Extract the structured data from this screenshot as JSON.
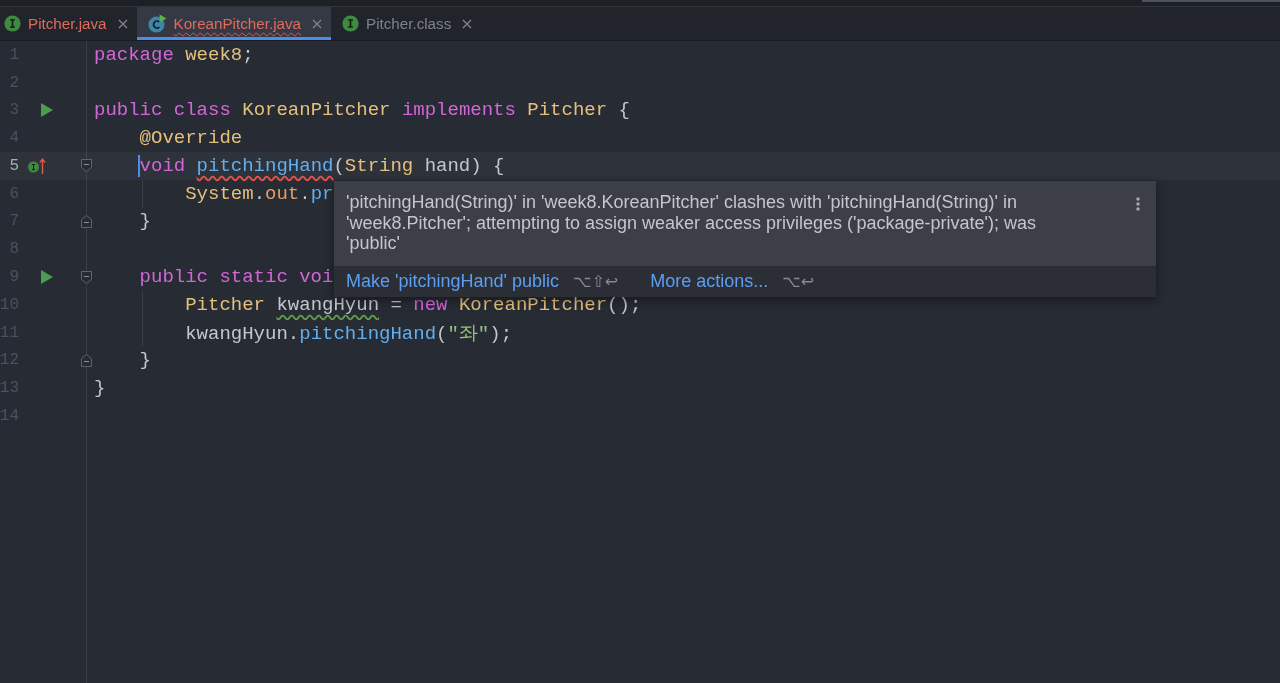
{
  "tabs": [
    {
      "label": "Pitcher.java",
      "kind": "interface",
      "selected": false,
      "error": true,
      "squiggle": false
    },
    {
      "label": "KoreanPitcher.java",
      "kind": "class",
      "selected": true,
      "error": true,
      "squiggle": true
    },
    {
      "label": "Pitcher.class",
      "kind": "interface",
      "selected": false,
      "error": false,
      "squiggle": false
    }
  ],
  "editor": {
    "lines": [
      {
        "number": "1",
        "current": false,
        "tokens": [
          {
            "text": "package ",
            "kind": "keyword"
          },
          {
            "text": "week8",
            "kind": "type"
          },
          {
            "text": ";",
            "kind": "plain"
          }
        ]
      },
      {
        "number": "2",
        "current": false
      },
      {
        "number": "3",
        "current": false,
        "gutter": [
          {
            "kind": "run"
          }
        ],
        "tokens": [
          {
            "text": "public class ",
            "kind": "keyword"
          },
          {
            "text": "KoreanPitcher ",
            "kind": "type"
          },
          {
            "text": "implements ",
            "kind": "keyword"
          },
          {
            "text": "Pitcher ",
            "kind": "type"
          },
          {
            "text": "{",
            "kind": "plain"
          }
        ],
        "children": [
          {
            "number": "4",
            "current": false,
            "tokens": [
              {
                "text": "@Override",
                "kind": "annotation"
              }
            ]
          },
          {
            "number": "5",
            "current": true,
            "gutter": [
              {
                "kind": "implements"
              }
            ],
            "fold": {
              "kind": "start"
            },
            "tokens": [
              {
                "text": "void ",
                "kind": "keyword"
              },
              {
                "text": "pitchingHand",
                "kind": "method",
                "squiggle": {
                  "kind": "error"
                }
              },
              {
                "text": "(",
                "kind": "plain"
              },
              {
                "text": "String",
                "kind": "type"
              },
              {
                "text": " hand) {",
                "kind": "plain"
              }
            ],
            "children": [
              {
                "number": "6",
                "current": false,
                "tokens": [
                  {
                    "text": "System",
                    "kind": "type"
                  },
                  {
                    "text": ".",
                    "kind": "plain"
                  },
                  {
                    "text": "out",
                    "kind": "field"
                  },
                  {
                    "text": ".",
                    "kind": "plain"
                  },
                  {
                    "text": "pr",
                    "kind": "method"
                  }
                ]
              }
            ]
          },
          {
            "number": "7",
            "current": false,
            "fold": {
              "kind": "end"
            },
            "tokens": [
              {
                "text": "}",
                "kind": "plain"
              }
            ]
          },
          {
            "number": "8",
            "current": false
          },
          {
            "number": "9",
            "current": false,
            "gutter": [
              {
                "kind": "run"
              }
            ],
            "fold": {
              "kind": "start"
            },
            "tokens": [
              {
                "text": "public static voi",
                "kind": "keyword"
              }
            ],
            "children": [
              {
                "number": "10",
                "current": false,
                "tokens": [
                  {
                    "text": "Pitcher ",
                    "kind": "type"
                  },
                  {
                    "text": "kwangHyun",
                    "kind": "plain",
                    "squiggle": {
                      "kind": "warning"
                    }
                  },
                  {
                    "text": " = ",
                    "kind": "plain"
                  },
                  {
                    "text": "new ",
                    "kind": "keyword"
                  },
                  {
                    "text": "KoreanPitcher",
                    "kind": "type"
                  },
                  {
                    "text": "();",
                    "kind": "plain"
                  }
                ]
              },
              {
                "number": "11",
                "current": false,
                "tokens": [
                  {
                    "text": "kwangHyun.",
                    "kind": "plain"
                  },
                  {
                    "text": "pitchingHand",
                    "kind": "method"
                  },
                  {
                    "text": "(",
                    "kind": "plain"
                  },
                  {
                    "text": "\"좌\"",
                    "kind": "string"
                  },
                  {
                    "text": ");",
                    "kind": "plain"
                  }
                ]
              }
            ]
          },
          {
            "number": "12",
            "current": false,
            "fold": {
              "kind": "end"
            },
            "tokens": [
              {
                "text": "}",
                "kind": "plain"
              }
            ]
          }
        ]
      },
      {
        "number": "13",
        "current": false,
        "tokens": [
          {
            "text": "}",
            "kind": "plain"
          }
        ]
      },
      {
        "number": "14",
        "current": false
      }
    ]
  },
  "popup": {
    "message": "'pitchingHand(String)' in 'week8.KoreanPitcher' clashes with 'pitchingHand(String)' in 'week8.Pitcher'; attempting to assign weaker access privileges ('package-private'); was 'public'",
    "actions": [
      {
        "label": "Make 'pitchingHand' public",
        "shortcut": "⌥⇧↩"
      },
      {
        "label": "More actions...",
        "shortcut": "⌥↩"
      }
    ]
  }
}
